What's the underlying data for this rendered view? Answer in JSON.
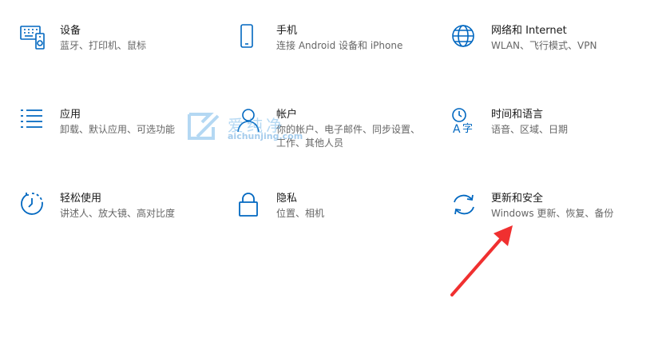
{
  "colors": {
    "icon_blue": "#0067c0",
    "title_text": "#1a1a1a",
    "desc_text": "#666666",
    "arrow_red": "#f03030"
  },
  "tiles": [
    {
      "title": "设备",
      "desc": "蓝牙、打印机、鼠标",
      "icon": "keyboard-device-icon"
    },
    {
      "title": "手机",
      "desc": "连接 Android 设备和 iPhone",
      "icon": "phone-icon"
    },
    {
      "title": "网络和 Internet",
      "desc": "WLAN、飞行模式、VPN",
      "icon": "globe-icon"
    },
    {
      "title": "应用",
      "desc": "卸载、默认应用、可选功能",
      "icon": "apps-list-icon"
    },
    {
      "title": "帐户",
      "desc": "你的帐户、电子邮件、同步设置、工作、其他人员",
      "icon": "person-icon"
    },
    {
      "title": "时间和语言",
      "desc": "语音、区域、日期",
      "icon": "time-language-icon"
    },
    {
      "title": "轻松使用",
      "desc": "讲述人、放大镜、高对比度",
      "icon": "ease-of-access-icon"
    },
    {
      "title": "隐私",
      "desc": "位置、相机",
      "icon": "lock-icon"
    },
    {
      "title": "更新和安全",
      "desc": "Windows 更新、恢复、备份",
      "icon": "sync-icon"
    }
  ],
  "watermark": {
    "cn": "爱纯净",
    "url": "aichunjing.com"
  }
}
